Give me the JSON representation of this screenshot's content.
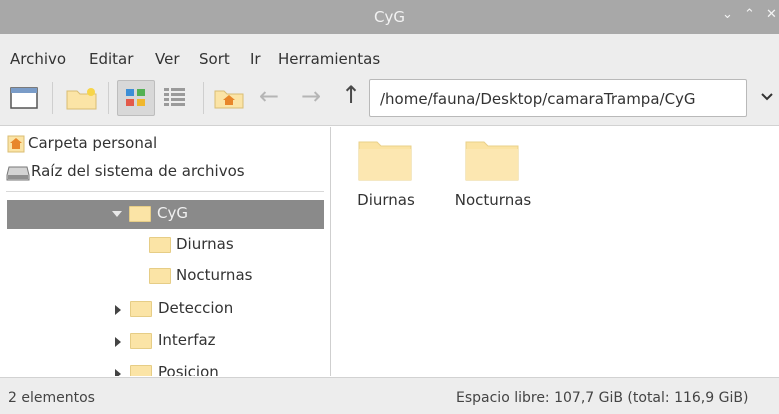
{
  "window": {
    "title": "CyG",
    "buttons": {
      "minimize": "⌄",
      "maximize": "⌃",
      "close": "✕"
    }
  },
  "menubar": {
    "items": [
      "Archivo",
      "Editar",
      "Ver",
      "Sort",
      "Ir",
      "Herramientas"
    ]
  },
  "toolbar": {
    "path": "/home/fauna/Desktop/camaraTrampa/CyG",
    "back_glyph": "←",
    "forward_glyph": "→",
    "up_glyph": "↑"
  },
  "sidebar": {
    "places": [
      {
        "label": "Carpeta personal",
        "icon": "home-icon"
      },
      {
        "label": "Raíz del sistema de archivos",
        "icon": "drive-icon"
      }
    ],
    "tree": [
      {
        "label": "CyG",
        "selected": true,
        "expander": "expanded"
      },
      {
        "label": "Diurnas",
        "selected": false,
        "expander": "none"
      },
      {
        "label": "Nocturnas",
        "selected": false,
        "expander": "none"
      },
      {
        "label": "Deteccion",
        "selected": false,
        "expander": "collapsed"
      },
      {
        "label": "Interfaz",
        "selected": false,
        "expander": "collapsed"
      },
      {
        "label": "Posicion",
        "selected": false,
        "expander": "collapsed"
      }
    ]
  },
  "main": {
    "items": [
      {
        "name": "Diurnas",
        "icon": "folder-icon"
      },
      {
        "name": "Nocturnas",
        "icon": "folder-icon"
      }
    ]
  },
  "statusbar": {
    "count": "2 elementos",
    "free_space": "Espacio libre: 107,7 GiB (total: 116,9 GiB)"
  },
  "colors": {
    "titlebar": "#a8a8a8",
    "selection": "#8a8a8a",
    "folder": "#fbe4a6",
    "home_icon": "#e8862a"
  }
}
